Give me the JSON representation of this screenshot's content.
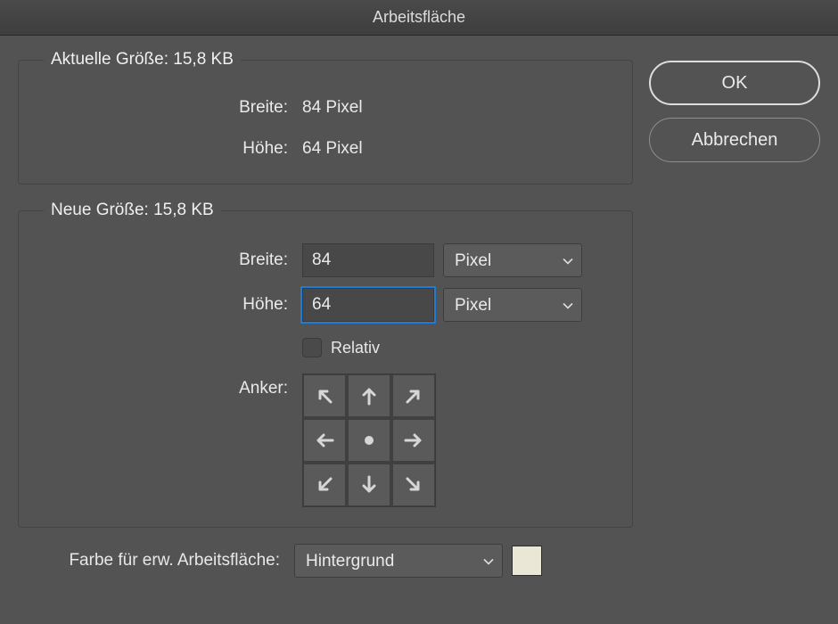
{
  "title": "Arbeitsfläche",
  "buttons": {
    "ok": "OK",
    "cancel": "Abbrechen"
  },
  "current_size": {
    "legend": "Aktuelle Größe: 15,8 KB",
    "width_label": "Breite:",
    "width_value": "84 Pixel",
    "height_label": "Höhe:",
    "height_value": "64 Pixel"
  },
  "new_size": {
    "legend": "Neue Größe: 15,8 KB",
    "width_label": "Breite:",
    "width_value": "84",
    "width_unit": "Pixel",
    "height_label": "Höhe:",
    "height_value": "64",
    "height_unit": "Pixel",
    "relative_label": "Relativ",
    "relative_checked": false,
    "anchor_label": "Anker:"
  },
  "extension_color": {
    "label": "Farbe für erw. Arbeitsfläche:",
    "value": "Hintergrund",
    "swatch": "#eae7d6"
  }
}
